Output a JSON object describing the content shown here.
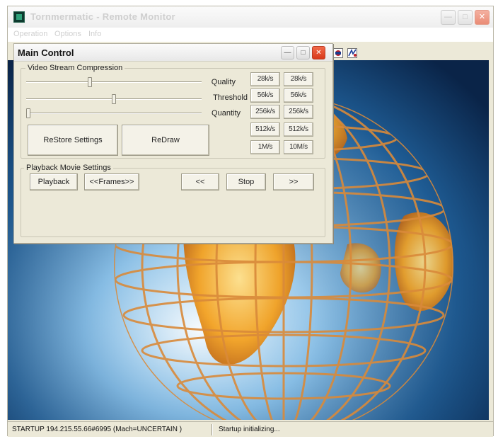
{
  "app": {
    "title": "Tornmermatic - Remote Monitor",
    "menu": [
      "Operation",
      "Options",
      "Info"
    ]
  },
  "dialog": {
    "title": "Main Control",
    "video_group": {
      "legend": "Video Stream Compression",
      "sliders": [
        {
          "label": "Quality",
          "level": 0.36
        },
        {
          "label": "Threshold",
          "level": 0.5
        },
        {
          "label": "Quantity",
          "level": 0.0
        }
      ],
      "rates": [
        [
          "28k/s",
          "28k/s"
        ],
        [
          "56k/s",
          "56k/s"
        ],
        [
          "256k/s",
          "256k/s"
        ],
        [
          "512k/s",
          "512k/s"
        ],
        [
          "1M/s",
          "10M/s"
        ]
      ],
      "restore_label": "ReStore Settings",
      "redraw_label": "ReDraw"
    },
    "playback_group": {
      "legend": "Playback Movie Settings",
      "playback_label": "Playback",
      "frames_label": "<<Frames>>",
      "rewind_label": "<<",
      "stop_label": "Stop",
      "forward_label": ">>"
    }
  },
  "status": {
    "left": "STARTUP 194.215.55.66#6995 (Mach=UNCERTAIN )",
    "right": "Startup initializing..."
  },
  "colors": {
    "close_button": "#d8391b",
    "viewport_background": "#1e5b93",
    "globe_grid": "#d98a3a",
    "continent": "#f0a020"
  }
}
